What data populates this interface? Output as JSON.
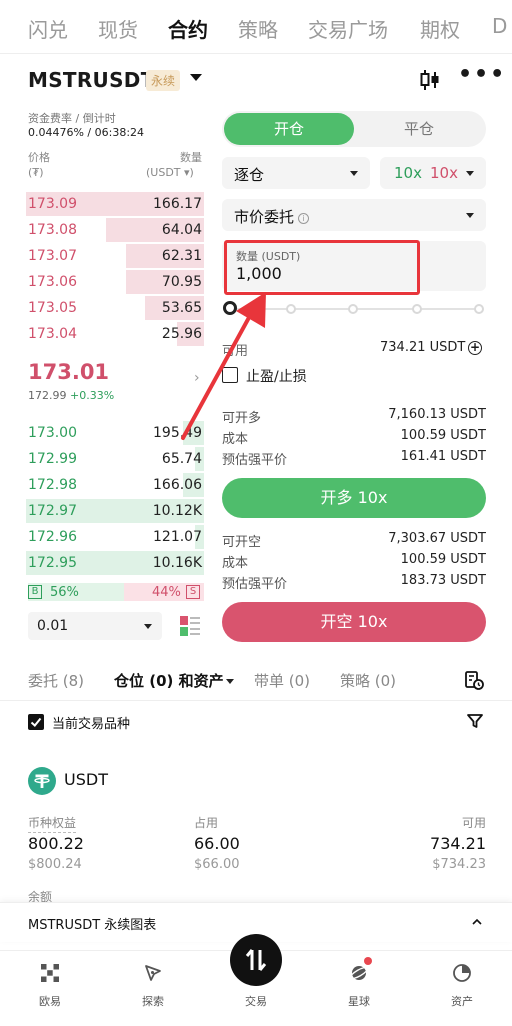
{
  "topnav": {
    "tabs": [
      {
        "label": "闪兑",
        "active": false
      },
      {
        "label": "现货",
        "active": false
      },
      {
        "label": "合约",
        "active": true
      },
      {
        "label": "策略",
        "active": false
      },
      {
        "label": "交易广场",
        "active": false
      },
      {
        "label": "期权",
        "active": false
      },
      {
        "label": "D",
        "active": false
      }
    ]
  },
  "pair": {
    "name": "MSTRUSDT",
    "badge": "永续"
  },
  "funding": {
    "label": "资金费率 / 倒计时",
    "value": "0.04476% / 06:38:24"
  },
  "orderbook": {
    "price_header": "价格",
    "price_unit": "(₮)",
    "qty_header": "数量",
    "qty_unit": "(USDT ▾)",
    "asks": [
      {
        "price": "173.09",
        "qty": "166.17",
        "depth": 1.0
      },
      {
        "price": "173.08",
        "qty": "64.04",
        "depth": 0.55
      },
      {
        "price": "173.07",
        "qty": "62.31",
        "depth": 0.44
      },
      {
        "price": "173.06",
        "qty": "70.95",
        "depth": 0.44
      },
      {
        "price": "173.05",
        "qty": "53.65",
        "depth": 0.33
      },
      {
        "price": "173.04",
        "qty": "25.96",
        "depth": 0.15
      }
    ],
    "last_price": "173.01",
    "mark_price": "172.99",
    "change": "+0.33%",
    "bids": [
      {
        "price": "173.00",
        "qty": "195.49",
        "depth": 0.12
      },
      {
        "price": "172.99",
        "qty": "65.74",
        "depth": 0.05
      },
      {
        "price": "172.98",
        "qty": "166.06",
        "depth": 0.12
      },
      {
        "price": "172.97",
        "qty": "10.12K",
        "depth": 1.0
      },
      {
        "price": "172.96",
        "qty": "121.07",
        "depth": 0.05
      },
      {
        "price": "172.95",
        "qty": "10.16K",
        "depth": 1.0
      }
    ],
    "ratio": {
      "buy_tag": "B",
      "buy_pct": "56%",
      "sell_pct": "44%",
      "sell_tag": "S"
    },
    "precision": "0.01"
  },
  "order_form": {
    "open_label": "开仓",
    "close_label": "平仓",
    "margin_mode": "逐仓",
    "lev_long": "10x",
    "lev_short": "10x",
    "order_type": "市价委托",
    "qty_label": "数量 (USDT)",
    "qty_value": "1,000",
    "slider_pct": 0,
    "avail_label": "可用",
    "avail_value": "734.21 USDT",
    "tpsl_label": "止盈/止损",
    "long": {
      "max_label": "可开多",
      "max_value": "7,160.13 USDT",
      "cost_label": "成本",
      "cost_value": "100.59 USDT",
      "liq_label": "预估强平价",
      "liq_value": "161.41 USDT",
      "button": "开多 10x"
    },
    "short": {
      "max_label": "可开空",
      "max_value": "7,303.67 USDT",
      "cost_label": "成本",
      "cost_value": "100.59 USDT",
      "liq_label": "预估强平价",
      "liq_value": "183.73 USDT",
      "button": "开空 10x"
    }
  },
  "positions_tabs": [
    {
      "label": "委托 (8)",
      "active": false
    },
    {
      "label": "仓位 (0) 和资产",
      "active": true
    },
    {
      "label": "带单 (0)",
      "active": false
    },
    {
      "label": "策略 (0)",
      "active": false
    }
  ],
  "filter": {
    "label": "当前交易品种"
  },
  "asset": {
    "name": "USDT",
    "equity_label": "币种权益",
    "equity": "800.22",
    "equity_usd": "$800.24",
    "used_label": "占用",
    "used": "66.00",
    "used_usd": "$66.00",
    "avail_label": "可用",
    "avail": "734.21",
    "avail_usd": "$734.23",
    "partial_label": "余额"
  },
  "chart_strip": {
    "label": "MSTRUSDT 永续图表"
  },
  "bottom_nav": [
    {
      "label": "欧易",
      "icon": "okx-logo-icon"
    },
    {
      "label": "探索",
      "icon": "explore-icon"
    },
    {
      "label": "交易",
      "icon": "trade-icon"
    },
    {
      "label": "星球",
      "icon": "planet-icon"
    },
    {
      "label": "资产",
      "icon": "assets-icon"
    }
  ],
  "colors": {
    "buy": "#4fbd6c",
    "sell": "#d9546e",
    "annotation": "#e8353b"
  }
}
